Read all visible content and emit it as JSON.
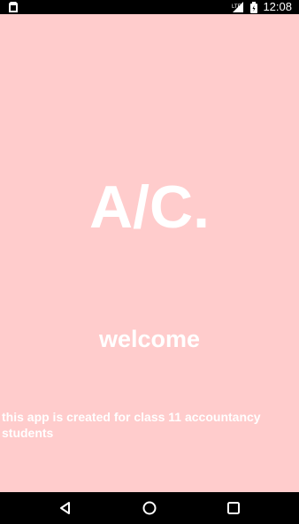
{
  "status_bar": {
    "time": "12:08",
    "left_icon": "sim-card-icon",
    "right_icons": [
      "signal-lte-icon",
      "battery-icon"
    ],
    "lte_label": "LTE"
  },
  "app": {
    "logo_text": "A/C.",
    "welcome": "welcome",
    "description": "this app is created for class 11 accountancy students",
    "background_color": "#ffcccc",
    "text_color": "#ffffff"
  },
  "nav_bar": {
    "buttons": [
      "back-icon",
      "home-icon",
      "recents-icon"
    ]
  }
}
